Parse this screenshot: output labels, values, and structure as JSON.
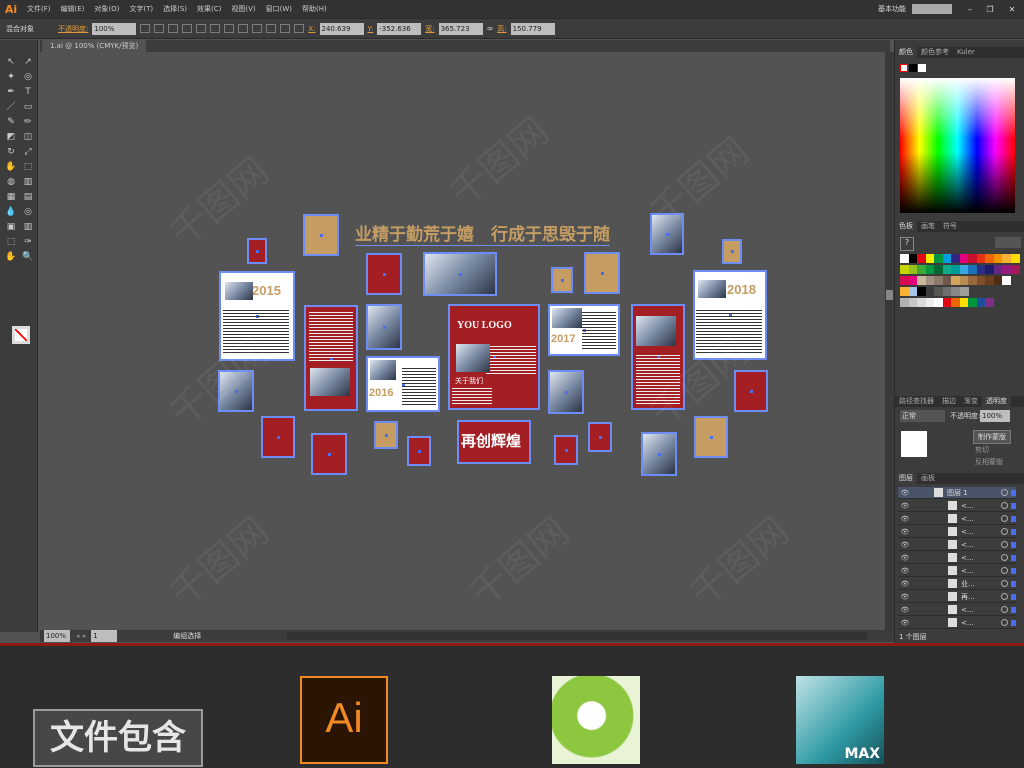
{
  "app": {
    "logo": "Ai",
    "workspace": "基本功能",
    "doc_tab": "1.ai @ 100% (CMYK/预览)"
  },
  "menu": [
    "文件(F)",
    "编辑(E)",
    "对象(O)",
    "文字(T)",
    "选择(S)",
    "效果(C)",
    "视图(V)",
    "窗口(W)",
    "帮助(H)"
  ],
  "control": {
    "selection": "混合对象",
    "opacity_label": "不透明度:",
    "opacity": "100%",
    "x_label": "X:",
    "x": "240.639",
    "y_label": "Y:",
    "y": "-352.636",
    "w_label": "宽:",
    "w": "365.723",
    "h_label": "高:",
    "h": "150.779"
  },
  "status": {
    "zoom": "100%",
    "page": "1",
    "tool": "编组选择"
  },
  "artwork": {
    "title": "业精于勤荒于嬉　行成于思毁于随",
    "years": [
      "2015",
      "2016",
      "2017",
      "2018"
    ],
    "logo": "YOU LOGO",
    "about": "关于我们",
    "slogan": "再创辉煌"
  },
  "panels": {
    "color_tabs": [
      "颜色",
      "颜色参考",
      "Kuler"
    ],
    "swatch_tabs": [
      "色板",
      "画笔",
      "符号"
    ],
    "trans_tabs": [
      "路径查找器",
      "描边",
      "渐变",
      "透明度"
    ],
    "blend_mode": "正常",
    "opacity_label": "不透明度:",
    "opacity": "100%",
    "make_mask": "制作蒙版",
    "clip": "剪切",
    "invert": "反相蒙版",
    "layer_tabs": [
      "图层",
      "画板"
    ],
    "layers": [
      "图层 1",
      "<...",
      "<...",
      "<...",
      "<...",
      "<...",
      "<...",
      "业...",
      "再...",
      "<...",
      "<..."
    ],
    "layer_count": "1 个图层"
  },
  "swatch_colors": [
    "#ffffff",
    "#000000",
    "#e30613",
    "#ffed00",
    "#009640",
    "#009fe3",
    "#312783",
    "#e5007d",
    "#c8102e",
    "#e63312",
    "#ec6608",
    "#f39200",
    "#f9b233",
    "#ffde00",
    "#c8d400",
    "#95c11f",
    "#3aaa35",
    "#009640",
    "#006633",
    "#13a98b",
    "#009c9a",
    "#36a9e1",
    "#1d71b8",
    "#2d2e83",
    "#1d1d6b",
    "#662483",
    "#951b81",
    "#a3195b",
    "#d60b52",
    "#e6007e",
    "#c9b99b",
    "#a39283",
    "#8d7a6a",
    "#6f5849",
    "#d6a461",
    "#b98c4f",
    "#98683f",
    "#7f4e2a",
    "#6b3e1e",
    "#4e2a14",
    "#ffffff",
    "#f9b233",
    "#a7c5eb",
    "#000000",
    "#3c3c3c",
    "#575756",
    "#706f6f",
    "#878787",
    "#9d9d9c",
    "#b2b2b2",
    "#c6c6c6",
    "#dadada",
    "#ededed",
    "#ffffff",
    "#e30613",
    "#ec6608",
    "#ffde00",
    "#009640",
    "#1d4f9c",
    "#7e2e84"
  ],
  "bottom": {
    "label": "文件包含",
    "apps": [
      "Ai",
      "MAX"
    ]
  }
}
